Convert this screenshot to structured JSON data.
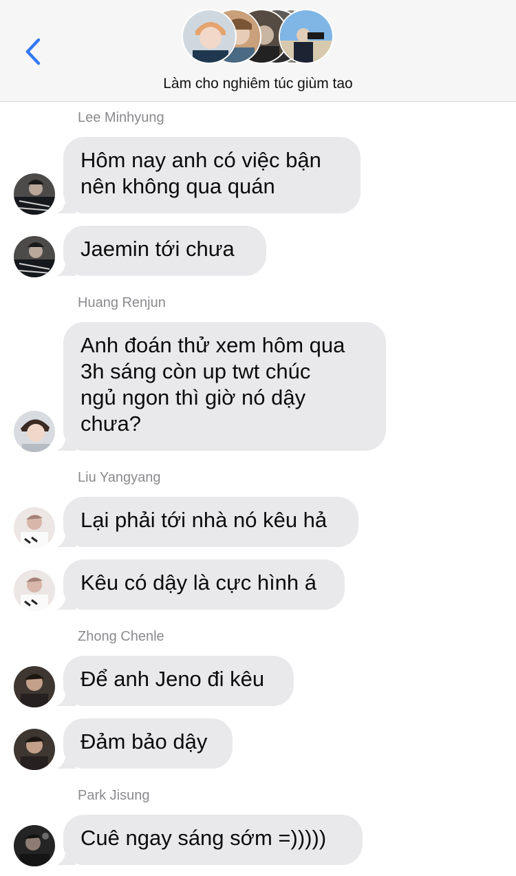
{
  "header": {
    "group_name": "Làm cho nghiêm túc giùm tao",
    "back_icon": "chevron-left-icon",
    "accent_color": "#3478f6"
  },
  "messages": [
    {
      "sender": "Lee Minhyung",
      "text_lines": [
        "Hôm nay anh có việc bận",
        "nên không qua quán"
      ]
    },
    {
      "sender": "Lee Minhyung",
      "text_lines": [
        "Jaemin tới chưa"
      ]
    },
    {
      "sender": "Huang Renjun",
      "text_lines": [
        "Anh đoán thử xem hôm qua",
        "3h sáng còn up twt chúc",
        "ngủ ngon thì giờ nó dậy",
        "chưa?"
      ]
    },
    {
      "sender": "Liu Yangyang",
      "text_lines": [
        "Lại phải tới nhà nó kêu hả"
      ]
    },
    {
      "sender": "Liu Yangyang",
      "text_lines": [
        "Kêu có dậy là cực hình á"
      ]
    },
    {
      "sender": "Zhong Chenle",
      "text_lines": [
        "Để anh Jeno đi kêu"
      ]
    },
    {
      "sender": "Zhong Chenle",
      "text_lines": [
        "Đảm bảo dậy"
      ]
    },
    {
      "sender": "Park Jisung",
      "text_lines": [
        "Cuê ngay sáng sớm =)))))"
      ]
    }
  ],
  "colors": {
    "incoming_bubble": "#e9e9eb",
    "header_bg": "#f6f6f6",
    "sender_name": "#8a8a8e"
  }
}
